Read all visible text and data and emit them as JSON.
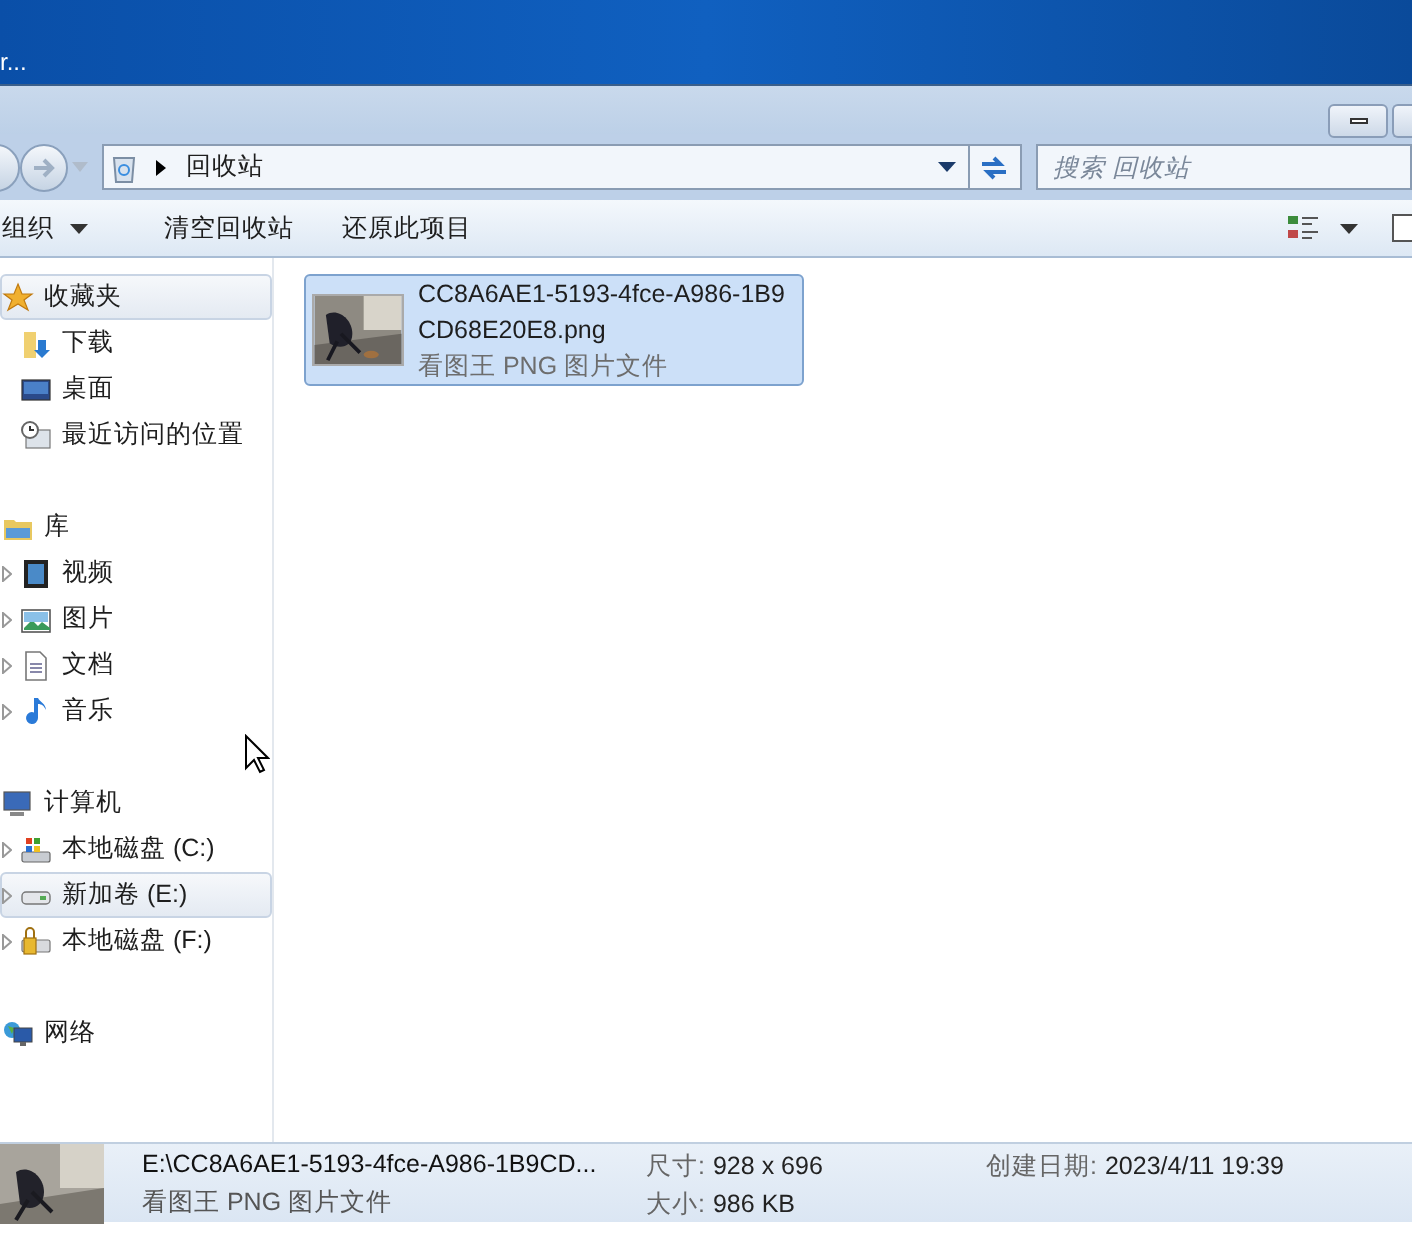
{
  "desktop": {
    "fragment": "r..."
  },
  "address": {
    "path": "回收站"
  },
  "search": {
    "placeholder": "搜索 回收站"
  },
  "toolbar": [
    {
      "label": "组织",
      "dropdown": true
    },
    {
      "label": "清空回收站",
      "dropdown": false
    },
    {
      "label": "还原此项目",
      "dropdown": false
    }
  ],
  "sidebar": [
    {
      "label": "收藏夹",
      "kind": "star",
      "highlighted": true,
      "children": [
        {
          "label": "下载",
          "kind": "download",
          "highlighted": false
        },
        {
          "label": "桌面",
          "kind": "desktop",
          "highlighted": false
        },
        {
          "label": "最近访问的位置",
          "kind": "recent",
          "highlighted": false
        }
      ]
    },
    {
      "label": "库",
      "kind": "library",
      "highlighted": false,
      "children": [
        {
          "label": "视频",
          "kind": "video",
          "highlighted": false,
          "expandable": true
        },
        {
          "label": "图片",
          "kind": "picture",
          "highlighted": false,
          "expandable": true
        },
        {
          "label": "文档",
          "kind": "document",
          "highlighted": false,
          "expandable": true
        },
        {
          "label": "音乐",
          "kind": "music",
          "highlighted": false,
          "expandable": true
        }
      ]
    },
    {
      "label": "计算机",
      "kind": "computer",
      "highlighted": false,
      "children": [
        {
          "label": "本地磁盘 (C:)",
          "kind": "drive-os",
          "highlighted": false,
          "expandable": true
        },
        {
          "label": "新加卷 (E:)",
          "kind": "drive",
          "highlighted": true,
          "expandable": true
        },
        {
          "label": "本地磁盘 (F:)",
          "kind": "drive-locked",
          "highlighted": false,
          "expandable": true
        }
      ]
    },
    {
      "label": "网络",
      "kind": "network",
      "highlighted": false
    }
  ],
  "files": [
    {
      "name": "CC8A6AE1-5193-4fce-A986-1B9CD68E20E8.png",
      "type": "看图王 PNG 图片文件",
      "selected": true,
      "kind": "picture"
    }
  ],
  "status_bar": {
    "path": "E:\\CC8A6AE1-5193-4fce-A986-1B9CD...",
    "type": "看图王 PNG 图片文件",
    "details": [
      {
        "label": "尺寸:",
        "value": "928 x 696"
      },
      {
        "label": "大小:",
        "value": "986 KB"
      },
      {
        "label": "创建日期:",
        "value": "2023/4/11 19:39"
      }
    ]
  }
}
